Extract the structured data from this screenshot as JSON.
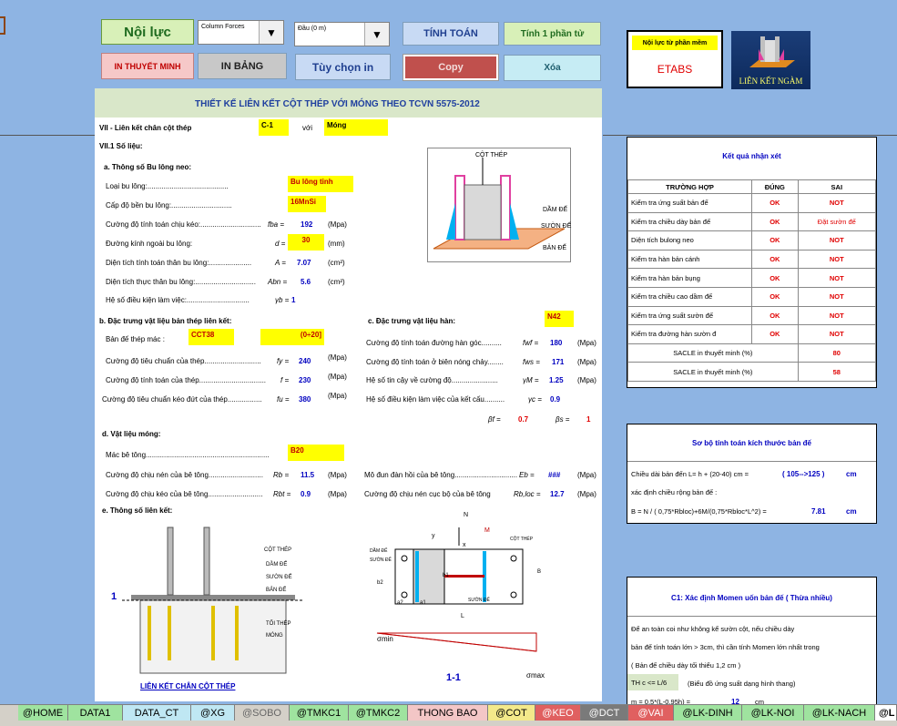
{
  "toolbar": {
    "noi_luc": "Nội lực",
    "column_forces": "Column Forces",
    "dau": "Đầu (0 m)",
    "tinh_toan": "TÍNH TOÁN",
    "tinh_1_phan_tu": "Tính 1 phần tử",
    "in_thuyet_minh": "IN THUYẾT MINH",
    "in_bang": "IN BẢNG",
    "tuy_chon_in": "Tùy chọn in",
    "copy": "Copy",
    "xoa": "Xóa",
    "source_label": "Nội lực từ phần mềm",
    "source_value": "ETABS",
    "logo_text": "LIÊN KẾT NGÀM"
  },
  "sheet": {
    "title": "THIẾT KẾ LIÊN KẾT CỘT THÉP VỚI MÓNG THEO TCVN 5575-2012",
    "sec7": "VII - Liên kết chân cột thép",
    "c1": "C-1",
    "voi": "với",
    "mong": "Móng",
    "sec71": "VII.1  Số liệu:",
    "a_title": "a. Thông số Bu lông neo:",
    "a_rows": [
      {
        "label": "Loại bu lông:........................................",
        "sym": "",
        "val": "Bu lông tinh",
        "unit": ""
      },
      {
        "label": "Cấp độ bền bu lông:..............................",
        "sym": "",
        "val": "16MnSi",
        "unit": ""
      },
      {
        "label": "Cường độ tính toán chịu kéo:..............................",
        "sym": "fba =",
        "val": "192",
        "unit": "(Mpa)"
      },
      {
        "label": "Đường kính ngoài bu lông:",
        "sym": "d =",
        "val": "30",
        "unit": "(mm)"
      },
      {
        "label": "Diện tích tính toán thân bu lông:.....................",
        "sym": "A =",
        "val": "7.07",
        "unit": "(cm²)"
      },
      {
        "label": "Diện tích thực thân bu lông:..............................",
        "sym": "Abn =",
        "val": "5.6",
        "unit": "(cm²)"
      },
      {
        "label": "Hệ số điều kiện làm việc:...............................",
        "sym": "γb =",
        "val": "1",
        "unit": ""
      }
    ],
    "b_title": "b. Đặc trưng vật liệu bản thép liên kết:",
    "b_rows": [
      {
        "label": "Bản đế thép mác :",
        "sym": "",
        "val": "CCT38",
        "unit": ""
      },
      {
        "label": "Cường độ tiêu chuẩn của thép............................",
        "sym": "fy =",
        "val": "240",
        "unit": "(Mpa)"
      },
      {
        "label": "Cường độ tính toán của thép.................................",
        "sym": "f =",
        "val": "230",
        "unit": "(Mpa)"
      },
      {
        "label": "Cường độ tiêu chuẩn kéo đứt của thép.................",
        "sym": "fu =",
        "val": "380",
        "unit": "(Mpa)"
      }
    ],
    "b_range": "(0÷20]",
    "c_title": "c. Đặc trưng vật liệu hàn:",
    "c_weld": "N42",
    "c_rows": [
      {
        "label": "Cường độ tính toán đường hàn góc..........",
        "sym": "fwf =",
        "val": "180",
        "unit": "(Mpa)"
      },
      {
        "label": "Cường độ tính toán ở biên nóng chảy........",
        "sym": "fws =",
        "val": "171",
        "unit": "(Mpa)"
      },
      {
        "label": "Hệ số tin cậy về cường độ.......................",
        "sym": "γM =",
        "val": "1.25",
        "unit": "(Mpa)"
      },
      {
        "label": "Hệ số điều kiện làm việc của kết cấu..........",
        "sym": "γc =",
        "val": "0.9",
        "unit": ""
      }
    ],
    "beta_f_sym": "βf =",
    "beta_f": "0.7",
    "beta_s_sym": "βs =",
    "beta_s": "1",
    "d_title": "d. Vật liệu móng:",
    "d_rows": [
      {
        "label": "Mác bê tông.............................................................",
        "sym": "",
        "val": "B20",
        "unit": ""
      },
      {
        "label": "Cường độ chịu nén của bê tông...........................",
        "sym": "Rb =",
        "val": "11.5",
        "unit": "(Mpa)"
      },
      {
        "label": "Cường độ chịu kéo của bê tông...........................",
        "sym": "Rbt =",
        "val": "0.9",
        "unit": "(Mpa)"
      }
    ],
    "d_right": [
      {
        "label": "Mô đun đàn hồi của bê tông...............................",
        "sym": "Eb =",
        "val": "###",
        "unit": "(Mpa)"
      },
      {
        "label": "Cường độ chịu nén cục bộ của bê tông",
        "sym": "Rb,loc =",
        "val": "12.7",
        "unit": "(Mpa)"
      }
    ],
    "e_title": "e. Thông số liên kết:",
    "fig3d": {
      "cot_thep": "CỘT THÉP",
      "dam_de": "DẦM ĐẾ",
      "suon_de": "SƯỜN ĐẾ",
      "ban_de": "BẢN ĐẾ"
    },
    "fig_section": {
      "cot_thep": "CỘT THÉP",
      "dam_de": "DẦM ĐẾ",
      "suon_de": "SƯỜN ĐẾ",
      "ban_de": "BẢN ĐẾ",
      "toi_thep": "TỐI THÉP",
      "mong": "MÓNG",
      "caption": "LIÊN KẾT CHÂN CỘT THÉP",
      "mark": "1"
    },
    "fig_plan": {
      "dam_de": "DẦM ĐẾ",
      "suon_de": "SƯỜN ĐẾ",
      "cot_thep": "CỘT THÉP",
      "suon_de2": "SƯỜN ĐẾ",
      "b2": "b2",
      "b1": "b1",
      "a2": "a2",
      "a1": "a1",
      "L": "L",
      "B": "B",
      "N": "N",
      "M": "M",
      "x": "x",
      "y": "y",
      "section": "1-1",
      "smin": "σmin",
      "smax": "σmax"
    }
  },
  "results": {
    "title": "Kết quả nhận xét",
    "h_case": "TRƯỜNG HỢP",
    "h_ok": "ĐÚNG",
    "h_not": "SAI",
    "rows": [
      {
        "case": "Kiểm tra ứng suất bản đế",
        "ok": "OK",
        "not": "NOT"
      },
      {
        "case": "Kiểm tra chiều dày bản đế",
        "ok": "OK",
        "not": "Đặt sườn đế"
      },
      {
        "case": "Diện tích bulong neo",
        "ok": "OK",
        "not": "NOT"
      },
      {
        "case": "Kiểm tra hàn bản cánh",
        "ok": "OK",
        "not": "NOT"
      },
      {
        "case": "Kiểm tra hàn bản bụng",
        "ok": "OK",
        "not": "NOT"
      },
      {
        "case": "Kiểm tra chiều cao dầm đế",
        "ok": "OK",
        "not": "NOT"
      },
      {
        "case": "Kiểm tra ứng suất sườn đế",
        "ok": "OK",
        "not": "NOT"
      },
      {
        "case": "Kiểm tra đường hàn sườn đ",
        "ok": "OK",
        "not": "NOT"
      }
    ],
    "scale1_label": "SACLE in thuyết minh (%)",
    "scale1": "80",
    "scale2_label": "SACLE in thuyết minh (%)",
    "scale2": "58"
  },
  "prelim": {
    "title": "Sơ bộ tính toán kích thước bản đế",
    "line1": "Chiều dài bản đến L= h + (20-40) cm =",
    "val1": "( 105-->125 )",
    "unit1": "cm",
    "line2": "xác định chiều rộng bản đế :",
    "line3": "B = N / ( 0,75*Rbloc)+6M/(0,75*Rbloc*L^2) =",
    "val3": "7.81",
    "unit3": "cm"
  },
  "moment": {
    "title": "C1: Xác định Momen uốn bản đế ( Thừa nhiều)",
    "line1": "Để an toàn coi như không kể sườn cột, nếu chiều dày",
    "line2": "bản đế tính toán lớn > 3cm, thì cần tính Momen lớn nhất trong",
    "line3": "( Bản đế chiều dày tối thiểu 1,2 cm )",
    "th": "TH c <= L/6",
    "th_note": "(Biểu đồ ứng suất dạng hình thang)",
    "m_line": "m = 0.5*(L-0.95h) =",
    "m_val": "12",
    "m_unit": "cm"
  },
  "tabs": [
    "@HOME",
    "DATA1",
    "DATA_CT",
    "@XG",
    "@SOBO",
    "@TMKC1",
    "@TMKC2",
    "THONG BAO",
    "@COT",
    "@KEO",
    "@DCT",
    "@VAI",
    "@LK-DINH",
    "@LK-NOI",
    "@LK-NACH",
    "@L"
  ],
  "colors": {
    "sheet_bg": "#8eb4e3",
    "title_band": "#d9e7c9",
    "highlight": "#ffff00",
    "ok": "#e00000",
    "value": "#0000c0"
  }
}
